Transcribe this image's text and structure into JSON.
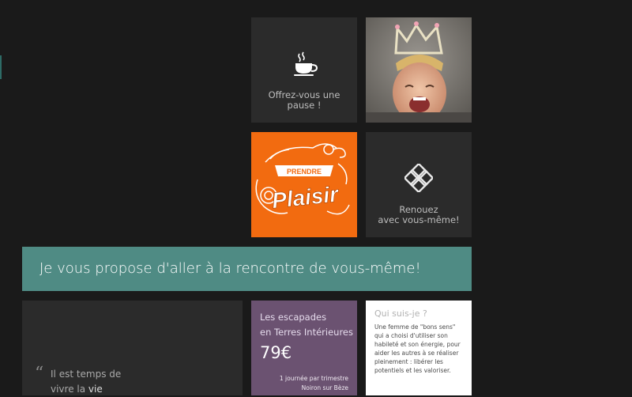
{
  "tiles": {
    "coffee": {
      "icon": "coffee-cup-icon",
      "caption": "Offrez-vous une pause !"
    },
    "photo": {
      "description_icon": "child-crown-photo"
    },
    "plaisir": {
      "logo_text": "PRENDRE PLAISIR",
      "color": "#f26b10"
    },
    "renouez": {
      "icon": "celtic-knot-icon",
      "caption_line1": "Renouez",
      "caption_line2": "avec vous-même!"
    }
  },
  "banner": {
    "text": "Je vous propose d'aller à la rencontre de vous-même!",
    "color": "#4f8b84"
  },
  "quote": {
    "mark": "“",
    "line1": "Il est temps de",
    "line2_prefix": "vivre la ",
    "line2_highlight": "vie"
  },
  "escapade": {
    "title_line1": "Les escapades",
    "title_line2": "en Terres Intérieures",
    "price": "79€",
    "detail_line1": "1 journée par trimestre",
    "detail_line2": "Noiron sur Bèze",
    "color": "#6b5271"
  },
  "qui": {
    "title": "Qui suis-je ?",
    "text": "Une femme de \"bons sens\" qui a choisi d'utiliser son habileté et son énergie, pour aider les autres à se réaliser pleinement : libérer les potentiels et les valoriser."
  }
}
